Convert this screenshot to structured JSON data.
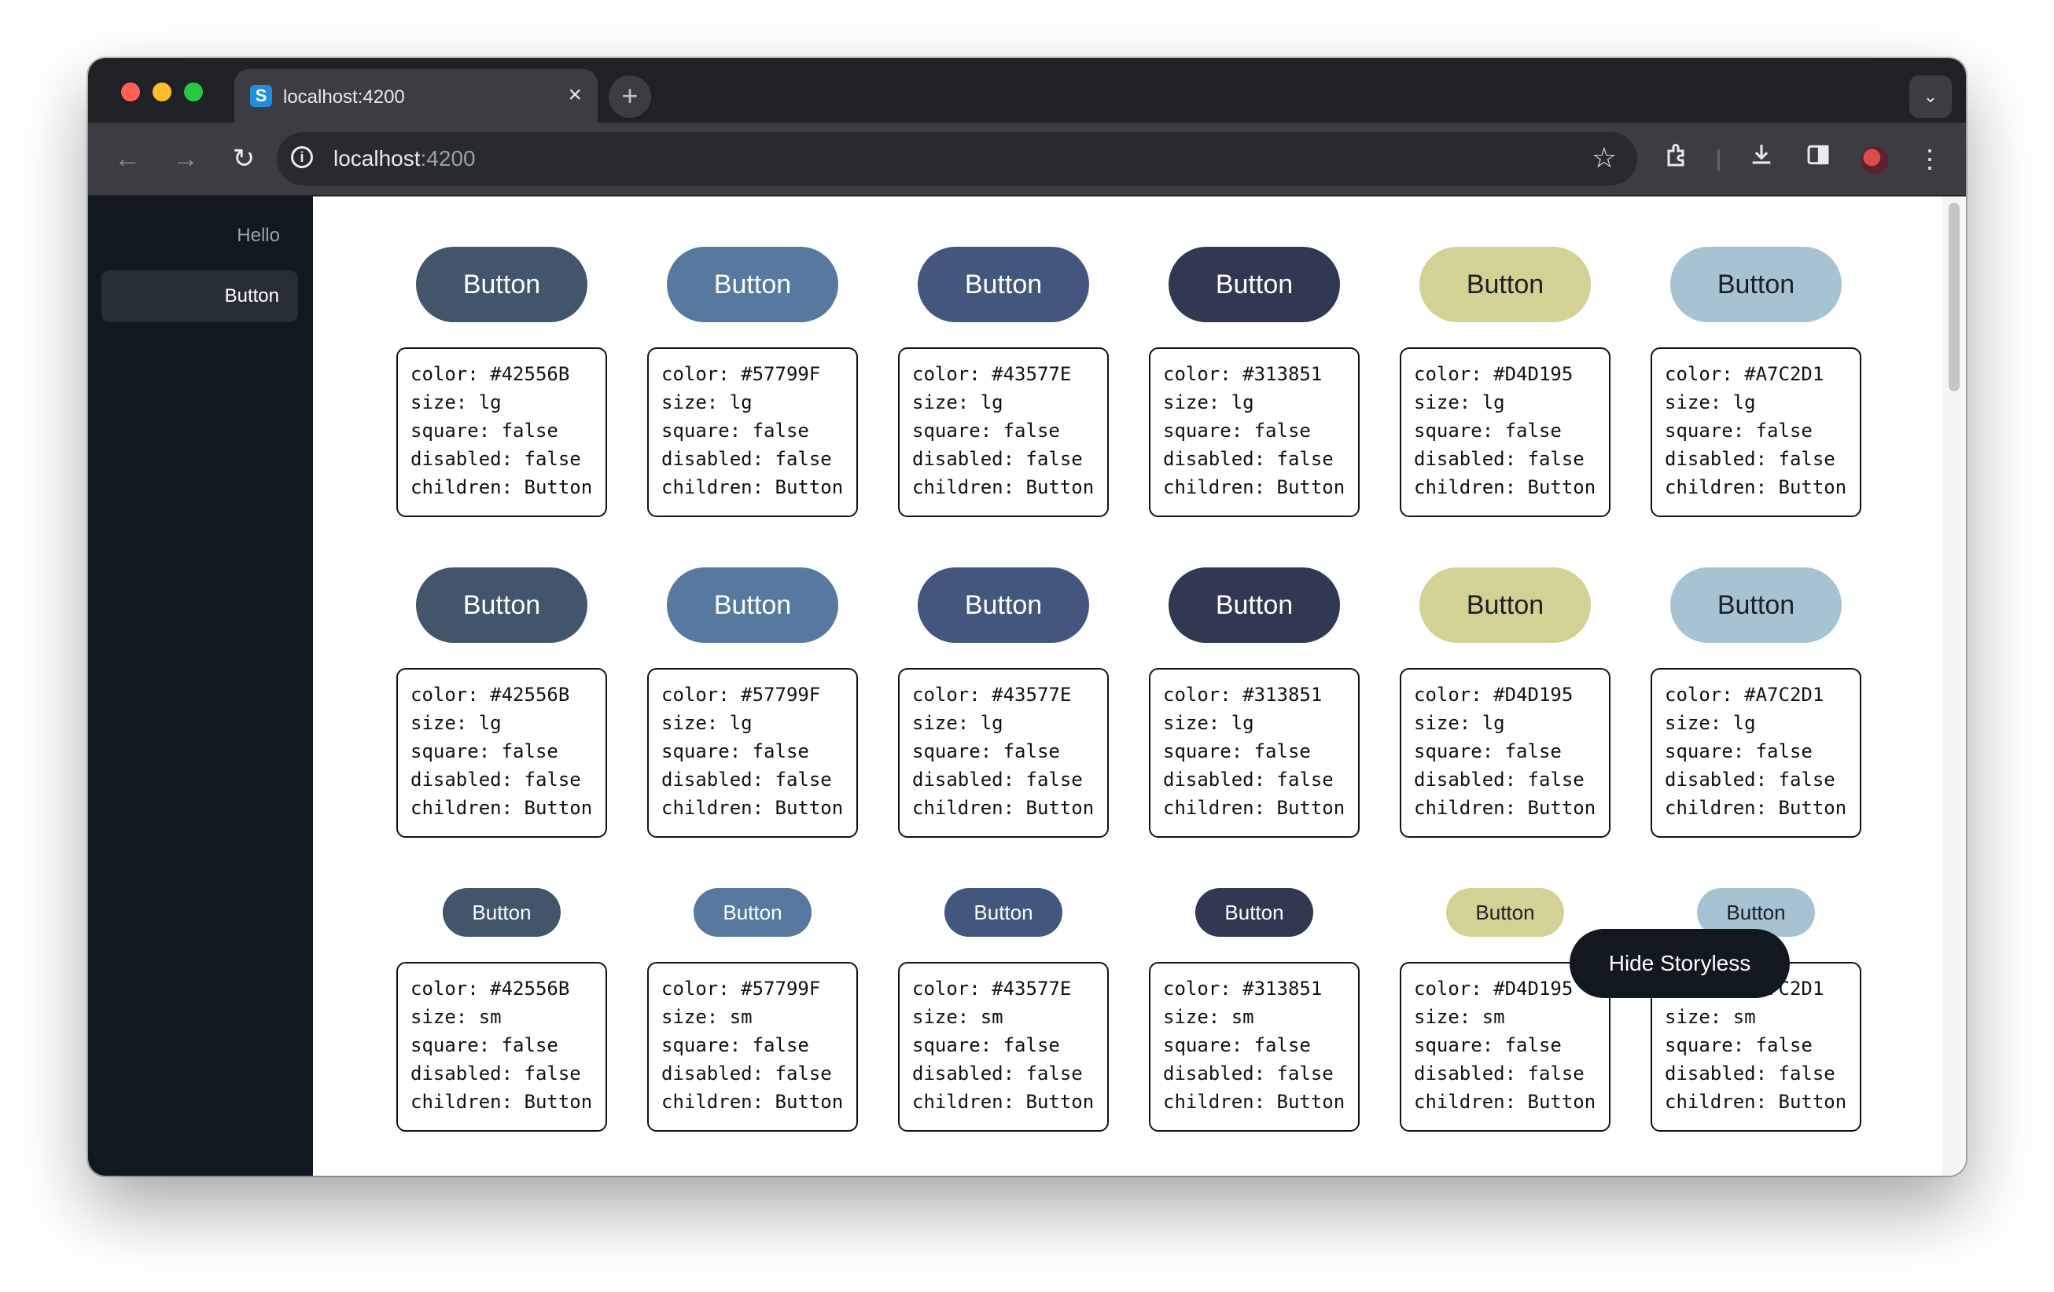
{
  "browser": {
    "tab_title": "localhost:4200",
    "tab_close": "×",
    "new_tab": "+",
    "tab_menu": "⌄",
    "url_host": "localhost",
    "url_port": ":4200",
    "icons": [
      "back-arrow-icon",
      "forward-arrow-icon",
      "reload-icon",
      "site-info-icon",
      "bookmark-star-icon",
      "extensions-icon",
      "download-icon",
      "side-panel-icon",
      "profile-avatar",
      "more-menu-icon"
    ]
  },
  "sidebar": {
    "heading": "Hello",
    "items": [
      {
        "label": "Button",
        "active": true
      }
    ]
  },
  "rows": [
    {
      "size": "lg",
      "cells": [
        {
          "label": "Button",
          "color": "#42556B",
          "info": "color: #42556B\nsize: lg\nsquare: false\ndisabled: false\nchildren: Button"
        },
        {
          "label": "Button",
          "color": "#57799F",
          "info": "color: #57799F\nsize: lg\nsquare: false\ndisabled: false\nchildren: Button"
        },
        {
          "label": "Button",
          "color": "#43577E",
          "info": "color: #43577E\nsize: lg\nsquare: false\ndisabled: false\nchildren: Button"
        },
        {
          "label": "Button",
          "color": "#313851",
          "info": "color: #313851\nsize: lg\nsquare: false\ndisabled: false\nchildren: Button"
        },
        {
          "label": "Button",
          "color": "#D4D195",
          "info": "color: #D4D195\nsize: lg\nsquare: false\ndisabled: false\nchildren: Button"
        },
        {
          "label": "Button",
          "color": "#A7C2D1",
          "info": "color: #A7C2D1\nsize: lg\nsquare: false\ndisabled: false\nchildren: Button"
        }
      ]
    },
    {
      "size": "lg",
      "cells": [
        {
          "label": "Button",
          "color": "#42556B",
          "info": "color: #42556B\nsize: lg\nsquare: false\ndisabled: false\nchildren: Button"
        },
        {
          "label": "Button",
          "color": "#57799F",
          "info": "color: #57799F\nsize: lg\nsquare: false\ndisabled: false\nchildren: Button"
        },
        {
          "label": "Button",
          "color": "#43577E",
          "info": "color: #43577E\nsize: lg\nsquare: false\ndisabled: false\nchildren: Button"
        },
        {
          "label": "Button",
          "color": "#313851",
          "info": "color: #313851\nsize: lg\nsquare: false\ndisabled: false\nchildren: Button"
        },
        {
          "label": "Button",
          "color": "#D4D195",
          "info": "color: #D4D195\nsize: lg\nsquare: false\ndisabled: false\nchildren: Button"
        },
        {
          "label": "Button",
          "color": "#A7C2D1",
          "info": "color: #A7C2D1\nsize: lg\nsquare: false\ndisabled: false\nchildren: Button"
        }
      ]
    },
    {
      "size": "sm",
      "cells": [
        {
          "label": "Button",
          "color": "#42556B",
          "info": "color: #42556B\nsize: sm\nsquare: false\ndisabled: false\nchildren: Button"
        },
        {
          "label": "Button",
          "color": "#57799F",
          "info": "color: #57799F\nsize: sm\nsquare: false\ndisabled: false\nchildren: Button"
        },
        {
          "label": "Button",
          "color": "#43577E",
          "info": "color: #43577E\nsize: sm\nsquare: false\ndisabled: false\nchildren: Button"
        },
        {
          "label": "Button",
          "color": "#313851",
          "info": "color: #313851\nsize: sm\nsquare: false\ndisabled: false\nchildren: Button"
        },
        {
          "label": "Button",
          "color": "#D4D195",
          "info": "color: #D4D195\nsize: sm\nsquare: false\ndisabled: false\nchildren: Button"
        },
        {
          "label": "Button",
          "color": "#A7C2D1",
          "info": "color: #A7C2D1\nsize: sm\nsquare: false\ndisabled: false\nchildren: Button"
        }
      ]
    }
  ],
  "floating_button": {
    "label": "Hide Storyless"
  }
}
